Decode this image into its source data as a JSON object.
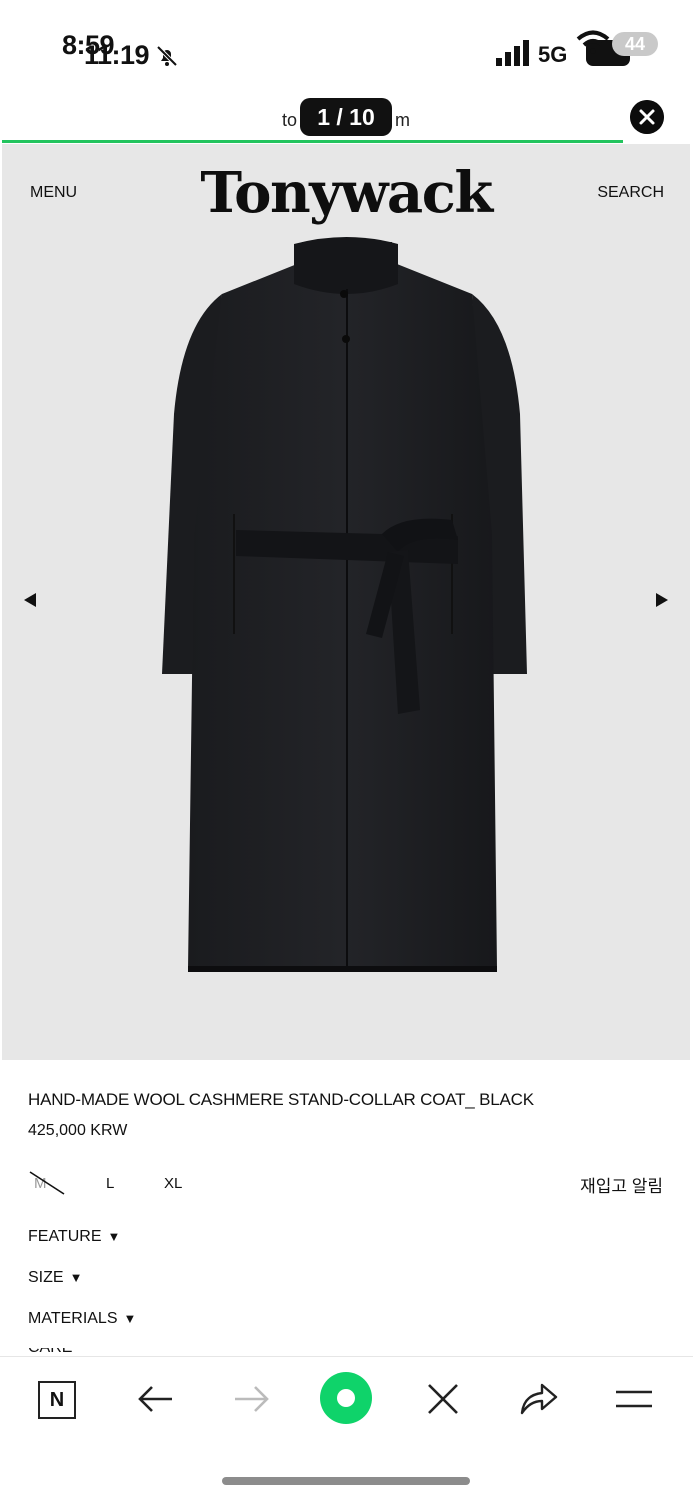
{
  "status_bar": {
    "time_back": "8:59",
    "time_front": "11:19",
    "network": "5G",
    "battery": "44"
  },
  "browser": {
    "url_left": "to",
    "url_right": "m",
    "page_counter": "1 / 10",
    "progress": 0.9
  },
  "site": {
    "menu_label": "MENU",
    "brand": "Tonywack",
    "search_label": "SEARCH"
  },
  "product": {
    "title": "HAND-MADE WOOL CASHMERE STAND-COLLAR COAT_ BLACK",
    "price": "425,000 KRW",
    "sizes": [
      "M",
      "L",
      "XL"
    ],
    "restock_label": "재입고 알림",
    "accordions": [
      "FEATURE",
      "SIZE",
      "MATERIALS",
      "CARE"
    ],
    "caret": "▼"
  },
  "toolbar": {
    "n_label": "N"
  },
  "colors": {
    "accent_green": "#0fd36a",
    "progress_green": "#23c45e",
    "hero_bg": "#e7e7e7"
  }
}
